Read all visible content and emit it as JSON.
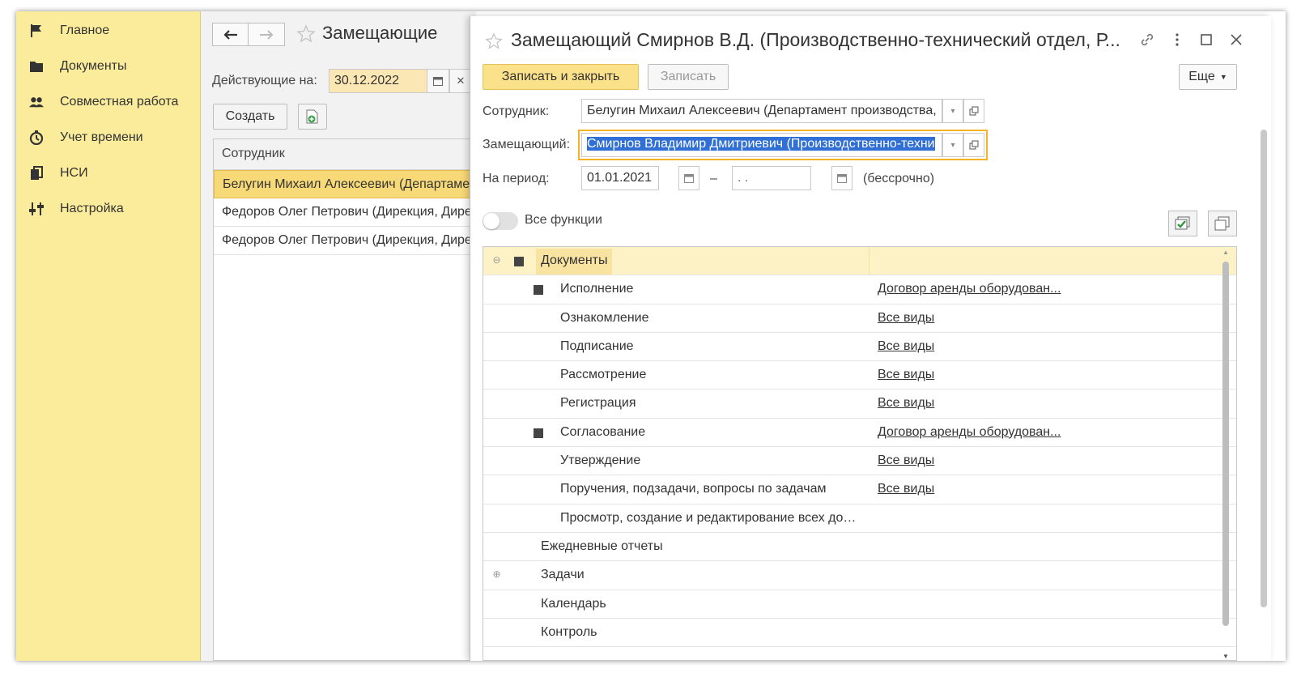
{
  "sidebar": {
    "items": [
      {
        "label": "Главное",
        "icon": "flag-icon"
      },
      {
        "label": "Документы",
        "icon": "folder-icon"
      },
      {
        "label": "Совместная работа",
        "icon": "people-icon"
      },
      {
        "label": "Учет времени",
        "icon": "timer-icon"
      },
      {
        "label": "НСИ",
        "icon": "books-icon"
      },
      {
        "label": "Настройка",
        "icon": "sliders-icon"
      }
    ]
  },
  "list": {
    "title": "Замещающие",
    "active_on_label": "Действующие на:",
    "active_on_value": "30.12.2022",
    "create_label": "Создать",
    "column_header": "Сотрудник",
    "rows": [
      "Белугин Михаил Алексеевич (Департамент",
      "Федоров Олег Петрович (Дирекция, Дире",
      "Федоров Олег Петрович (Дирекция, Дире"
    ]
  },
  "modal": {
    "title": "Замещающий Смирнов В.Д. (Производственно-технический отдел, Р...",
    "save_close_label": "Записать и закрыть",
    "save_label": "Записать",
    "more_label": "Еще",
    "employee_label": "Сотрудник:",
    "employee_value": "Белугин Михаил Алексеевич (Департамент производства,",
    "substitute_label": "Замещающий:",
    "substitute_value": "Смирнов Владимир Дмитриевич (Производственно-техни",
    "period_label": "На период:",
    "period_from": "01.01.2021",
    "period_dash": "–",
    "period_to": " .  .",
    "period_note": "(бессрочно)",
    "all_functions_label": "Все функции",
    "grid_rows": [
      {
        "name": "Документы",
        "value": ""
      },
      {
        "name": "Исполнение",
        "value": "Договор аренды оборудован..."
      },
      {
        "name": "Ознакомление",
        "value": "Все виды"
      },
      {
        "name": "Подписание",
        "value": "Все виды"
      },
      {
        "name": "Рассмотрение",
        "value": "Все виды"
      },
      {
        "name": "Регистрация",
        "value": "Все виды"
      },
      {
        "name": "Согласование",
        "value": "Договор аренды оборудован..."
      },
      {
        "name": "Утверждение",
        "value": "Все виды"
      },
      {
        "name": "Поручения, подзадачи, вопросы по задачам",
        "value": "Все виды"
      },
      {
        "name": "Просмотр, создание и редактирование всех до…",
        "value": ""
      },
      {
        "name": "Ежедневные отчеты",
        "value": ""
      },
      {
        "name": "Задачи",
        "value": ""
      },
      {
        "name": "Календарь",
        "value": ""
      },
      {
        "name": "Контроль",
        "value": ""
      }
    ]
  },
  "colors": {
    "sidebar_bg": "#fbec9c",
    "accent_yellow": "#fbe18a",
    "focus_border": "#f5b324",
    "selection_blue": "#2f6fd6"
  }
}
